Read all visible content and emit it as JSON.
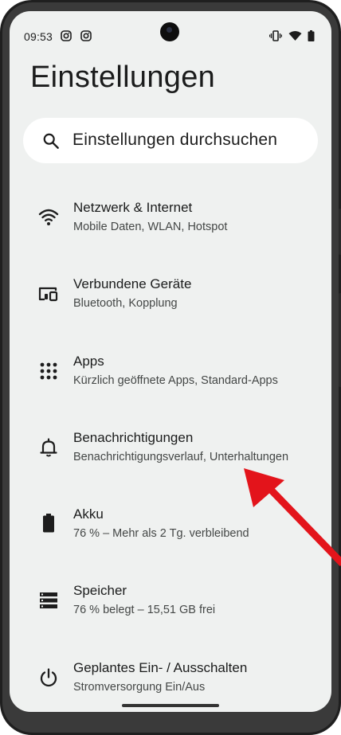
{
  "status_bar": {
    "time": "09:53",
    "left_icons": [
      "instagram-icon",
      "instagram-icon"
    ],
    "right_icons": [
      "vibrate-icon",
      "wifi-icon",
      "battery-icon"
    ]
  },
  "header": {
    "title": "Einstellungen"
  },
  "search": {
    "placeholder": "Einstellungen durchsuchen",
    "icon": "search-icon"
  },
  "settings": {
    "items": [
      {
        "title": "Netzwerk & Internet",
        "subtitle": "Mobile Daten, WLAN, Hotspot",
        "icon": "wifi-icon"
      },
      {
        "title": "Verbundene Geräte",
        "subtitle": "Bluetooth, Kopplung",
        "icon": "connected-devices-icon"
      },
      {
        "title": "Apps",
        "subtitle": "Kürzlich geöffnete Apps, Standard-Apps",
        "icon": "apps-grid-icon"
      },
      {
        "title": "Benachrichtigungen",
        "subtitle": "Benachrichtigungsverlauf, Unterhaltungen",
        "icon": "bell-icon"
      },
      {
        "title": "Akku",
        "subtitle": "76 % – Mehr als 2 Tg. verbleibend",
        "icon": "battery-icon"
      },
      {
        "title": "Speicher",
        "subtitle": "76 % belegt – 15,51 GB frei",
        "icon": "storage-icon"
      },
      {
        "title": "Geplantes Ein- / Ausschalten",
        "subtitle": "Stromversorgung Ein/Aus",
        "icon": "power-icon"
      }
    ]
  },
  "colors": {
    "screen_background": "#eff1f0",
    "search_background": "#ffffff",
    "text_primary": "#1b1c1c",
    "text_secondary": "#444746",
    "annotation_arrow": "#e3141b"
  }
}
